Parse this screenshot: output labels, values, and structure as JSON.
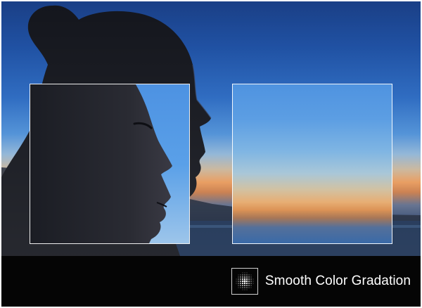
{
  "feature": {
    "label": "Smooth Color Gradation",
    "icon": "dot-gradation-icon"
  },
  "colors": {
    "sky_top": "#1a3f86",
    "sky_mid": "#2a69c0",
    "horizon_orange": "#e8995a",
    "water": "#142947",
    "silhouette": "#14161d",
    "frame_border": "#ffffff",
    "bar_background": "#050505"
  }
}
